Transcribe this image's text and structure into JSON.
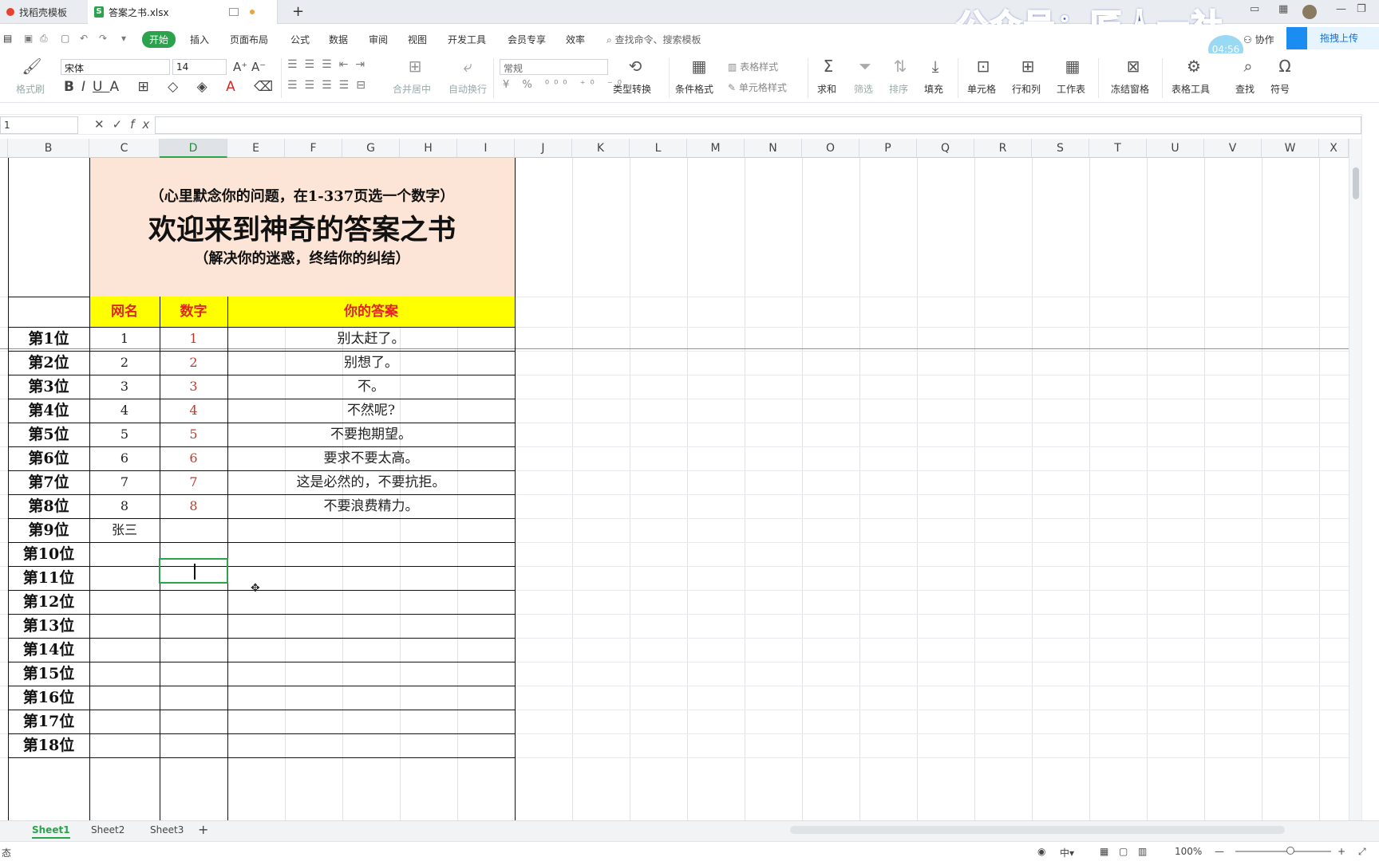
{
  "tabs": [
    {
      "label": "找稻壳模板",
      "active": false
    },
    {
      "label": "答案之书.xlsx",
      "active": true
    }
  ],
  "watermark": "公众号：匠人一社",
  "timer": "04:56",
  "collab": "协作",
  "upload": "拖拽上传",
  "menu": [
    "开始",
    "插入",
    "页面布局",
    "公式",
    "数据",
    "审阅",
    "视图",
    "开发工具",
    "会员专享",
    "效率"
  ],
  "menu_search": "查找命令、搜索模板",
  "ribbon": {
    "format_painter": "格式刷",
    "font": "宋体",
    "size": "14",
    "merge": "合并居中",
    "wrap": "自动换行",
    "number_format": "常规",
    "type_convert": "类型转换",
    "cond_format": "条件格式",
    "table_style": "表格样式",
    "cell_style": "单元格样式",
    "sum": "求和",
    "filter": "筛选",
    "sort": "排序",
    "fill": "填充",
    "cell": "单元格",
    "rowcol": "行和列",
    "worksheet": "工作表",
    "freeze": "冻结窗格",
    "table_tools": "表格工具",
    "find": "查找",
    "symbol": "符号"
  },
  "namebox": "1",
  "fx": "fx",
  "columns": [
    "B",
    "C",
    "D",
    "E",
    "F",
    "G",
    "H",
    "I",
    "J",
    "K",
    "L",
    "M",
    "N",
    "O",
    "P",
    "Q",
    "R",
    "S",
    "T",
    "U",
    "V",
    "W",
    "X"
  ],
  "selected_column": "D",
  "sheet": {
    "hint": "（心里默念你的问题，在1-337页选一个数字）",
    "title": "欢迎来到神奇的答案之书",
    "subtitle": "（解决你的迷惑，终结你的纠结）",
    "headers": {
      "name": "网名",
      "number": "数字",
      "answer": "你的答案"
    },
    "rows": [
      {
        "rank": "第1位",
        "name": "1",
        "number": "1",
        "answer": "别太赶了。"
      },
      {
        "rank": "第2位",
        "name": "2",
        "number": "2",
        "answer": "别想了。"
      },
      {
        "rank": "第3位",
        "name": "3",
        "number": "3",
        "answer": "不。"
      },
      {
        "rank": "第4位",
        "name": "4",
        "number": "4",
        "answer": "不然呢?"
      },
      {
        "rank": "第5位",
        "name": "5",
        "number": "5",
        "answer": "不要抱期望。"
      },
      {
        "rank": "第6位",
        "name": "6",
        "number": "6",
        "answer": "要求不要太高。"
      },
      {
        "rank": "第7位",
        "name": "7",
        "number": "7",
        "answer": "这是必然的，不要抗拒。"
      },
      {
        "rank": "第8位",
        "name": "8",
        "number": "8",
        "answer": "不要浪费精力。"
      },
      {
        "rank": "第9位",
        "name": "张三",
        "number": "",
        "answer": ""
      },
      {
        "rank": "第10位",
        "name": "",
        "number": "",
        "answer": ""
      },
      {
        "rank": "第11位",
        "name": "",
        "number": "",
        "answer": ""
      },
      {
        "rank": "第12位",
        "name": "",
        "number": "",
        "answer": ""
      },
      {
        "rank": "第13位",
        "name": "",
        "number": "",
        "answer": ""
      },
      {
        "rank": "第14位",
        "name": "",
        "number": "",
        "answer": ""
      },
      {
        "rank": "第15位",
        "name": "",
        "number": "",
        "answer": ""
      },
      {
        "rank": "第16位",
        "name": "",
        "number": "",
        "answer": ""
      },
      {
        "rank": "第17位",
        "name": "",
        "number": "",
        "answer": ""
      },
      {
        "rank": "第18位",
        "name": "",
        "number": "",
        "answer": ""
      }
    ]
  },
  "sheets": [
    "Sheet1",
    "Sheet2",
    "Sheet3"
  ],
  "status": {
    "left": "态",
    "zoom": "100%"
  },
  "colors": {
    "accent": "#2ba24c",
    "header_fill": "#ffff00",
    "header_text": "#e0261e",
    "title_fill": "#fce5d6",
    "number_text": "#c0392b"
  }
}
